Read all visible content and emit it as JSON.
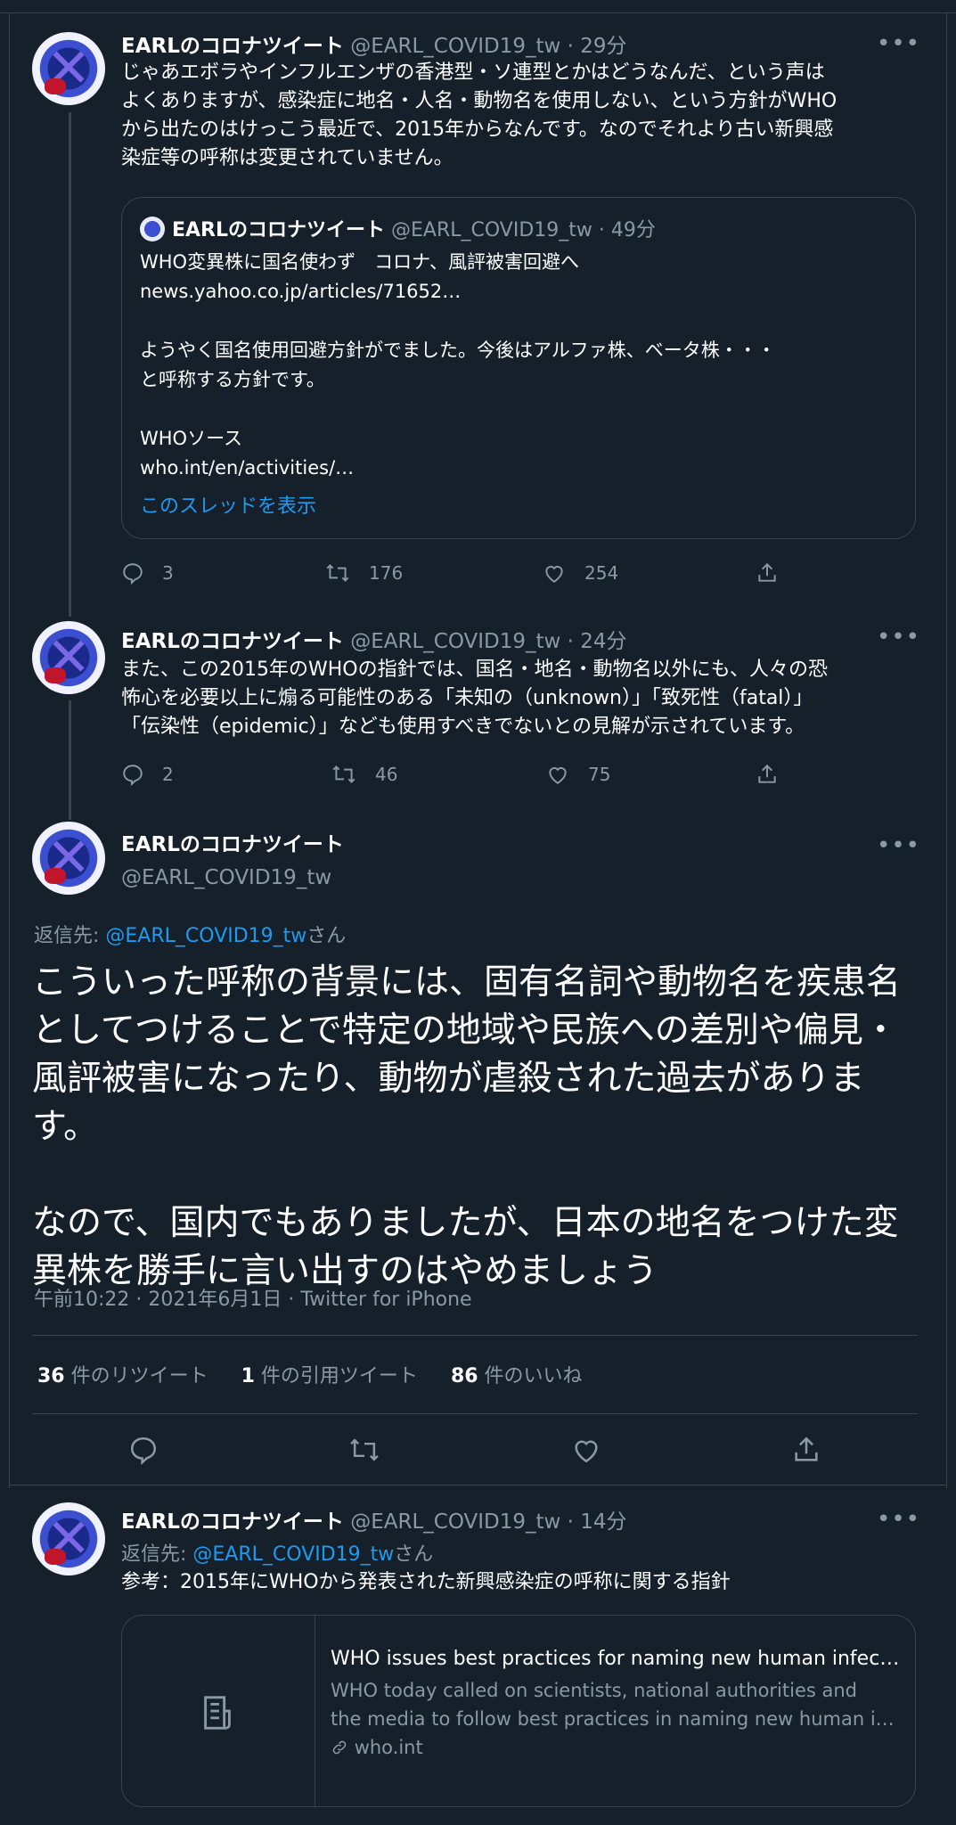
{
  "colors": {
    "background": "#15202b",
    "text": "#ffffff",
    "muted": "#8b98a5",
    "link": "#1d9bf0",
    "border": "#38444d"
  },
  "tweet1": {
    "name": "EARLのコロナツイート",
    "handle_time": "@EARL_COVID19_tw · 29分",
    "text": "じゃあエボラやインフルエンザの香港型・ソ連型とかはどうなんだ、という声は\nよくありますが、感染症に地名・人名・動物名を使用しない、という方針がWHO\nから出たのはけっこう最近で、2015年からなんです。なのでそれより古い新興感\n染症等の呼称は変更されていません。",
    "quote": {
      "name": "EARLのコロナツイート",
      "handle_time": "@EARL_COVID19_tw · 49分",
      "text": "WHO変異株に国名使わず　コロナ、風評被害回避へ\nnews.yahoo.co.jp/articles/71652…\n\nようやく国名使用回避方針がでました。今後はアルファ株、ベータ株・・・\nと呼称する方針です。\n\nWHOソース\nwho.int/en/activities/…",
      "show_thread": "このスレッドを表示"
    },
    "replies": "3",
    "retweets": "176",
    "likes": "254"
  },
  "tweet2": {
    "name": "EARLのコロナツイート",
    "handle_time": "@EARL_COVID19_tw · 24分",
    "text": "また、この2015年のWHOの指針では、国名・地名・動物名以外にも、人々の恐\n怖心を必要以上に煽る可能性のある「未知の（unknown）」「致死性（fatal）」\n「伝染性（epidemic）」なども使用すべきでないとの見解が示されています。",
    "replies": "2",
    "retweets": "46",
    "likes": "75"
  },
  "main": {
    "name": "EARLのコロナツイート",
    "handle": "@EARL_COVID19_tw",
    "reply_to_prefix": "返信先: ",
    "reply_to_handle": "@EARL_COVID19_tw",
    "reply_to_suffix": "さん",
    "text": "こういった呼称の背景には、固有名詞や動物名を疾患名\nとしてつけることで特定の地域や民族への差別や偏見・\n風評被害になったり、動物が虐殺された過去がありま\nす。\n\nなので、国内でもありましたが、日本の地名をつけた変\n異株を勝手に言い出すのはやめましょう",
    "timestamp": "午前10:22 · 2021年6月1日 · Twitter for iPhone",
    "retweet_count": "36",
    "retweet_label": " 件のリツイート",
    "quote_count": "1",
    "quote_label": " 件の引用ツイート",
    "like_count": "86",
    "like_label": " 件のいいね"
  },
  "tweet3": {
    "name": "EARLのコロナツイート",
    "handle_time": "@EARL_COVID19_tw · 14分",
    "reply_to_prefix": "返信先: ",
    "reply_to_handle": "@EARL_COVID19_tw",
    "reply_to_suffix": "さん",
    "text": "参考：2015年にWHOから発表された新興感染症の呼称に関する指針",
    "card": {
      "title": "WHO issues best practices for naming new human infections",
      "desc_line1": "WHO today called on scientists, national authorities and",
      "desc_line2": "the media to follow best practices in naming new human infectious diseases",
      "domain": "who.int"
    }
  },
  "icons": [
    "reply-icon",
    "retweet-icon",
    "like-icon",
    "share-icon",
    "more-icon",
    "link-icon",
    "article-icon"
  ]
}
